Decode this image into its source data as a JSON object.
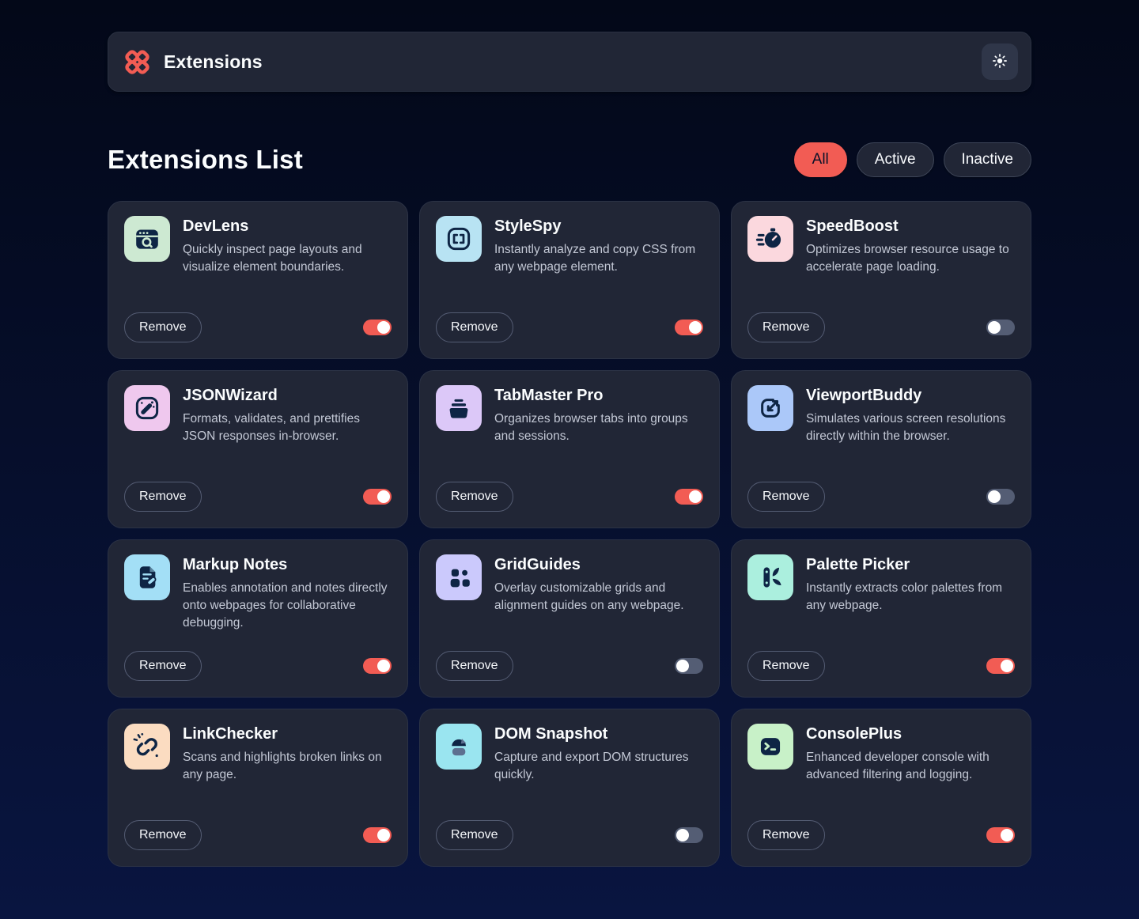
{
  "header": {
    "title": "Extensions",
    "logo_icon": "extensions-logo-icon",
    "theme_icon": "sun-icon"
  },
  "list": {
    "heading": "Extensions List",
    "filters": [
      {
        "label": "All",
        "active": true
      },
      {
        "label": "Active",
        "active": false
      },
      {
        "label": "Inactive",
        "active": false
      }
    ]
  },
  "card": {
    "remove_label": "Remove"
  },
  "extensions": [
    {
      "name": "DevLens",
      "description": "Quickly inspect page layouts and visualize element boundaries.",
      "icon": "devlens-icon",
      "icon_bg": "#CDE9D2",
      "active": true
    },
    {
      "name": "StyleSpy",
      "description": "Instantly analyze and copy CSS from any webpage element.",
      "icon": "stylespy-icon",
      "icon_bg": "#B8E3F3",
      "active": true
    },
    {
      "name": "SpeedBoost",
      "description": "Optimizes browser resource usage to accelerate page loading.",
      "icon": "speedboost-icon",
      "icon_bg": "#FBD8DE",
      "active": false
    },
    {
      "name": "JSONWizard",
      "description": "Formats, validates, and prettifies JSON responses in-browser.",
      "icon": "jsonwizard-icon",
      "icon_bg": "#EFC8EE",
      "active": true
    },
    {
      "name": "TabMaster Pro",
      "description": "Organizes browser tabs into groups and sessions.",
      "icon": "tabmaster-icon",
      "icon_bg": "#DCC8F8",
      "active": true
    },
    {
      "name": "ViewportBuddy",
      "description": "Simulates various screen resolutions directly within the browser.",
      "icon": "viewportbuddy-icon",
      "icon_bg": "#ABC8F9",
      "active": false
    },
    {
      "name": "Markup Notes",
      "description": "Enables annotation and notes directly onto webpages for collaborative debugging.",
      "icon": "markupnotes-icon",
      "icon_bg": "#A3DFF6",
      "active": true
    },
    {
      "name": "GridGuides",
      "description": "Overlay customizable grids and alignment guides on any webpage.",
      "icon": "gridguides-icon",
      "icon_bg": "#CBC9FC",
      "active": false
    },
    {
      "name": "Palette Picker",
      "description": "Instantly extracts color palettes from any webpage.",
      "icon": "palettepicker-icon",
      "icon_bg": "#ABEFDE",
      "active": true
    },
    {
      "name": "LinkChecker",
      "description": "Scans and highlights broken links on any page.",
      "icon": "linkchecker-icon",
      "icon_bg": "#FBDCC1",
      "active": true
    },
    {
      "name": "DOM Snapshot",
      "description": "Capture and export DOM structures quickly.",
      "icon": "domsnapshot-icon",
      "icon_bg": "#9AE5F0",
      "active": false
    },
    {
      "name": "ConsolePlus",
      "description": "Enhanced developer console with advanced filtering and logging.",
      "icon": "consoleplus-icon",
      "icon_bg": "#C8F1C8",
      "active": true
    }
  ],
  "colors": {
    "accent_red": "#F25C54",
    "page_gradient_top": "#030818",
    "page_gradient_bottom": "#091540",
    "surface": "#212636",
    "glyph_navy": "#0E2545",
    "toggle_off": "#545D74"
  }
}
